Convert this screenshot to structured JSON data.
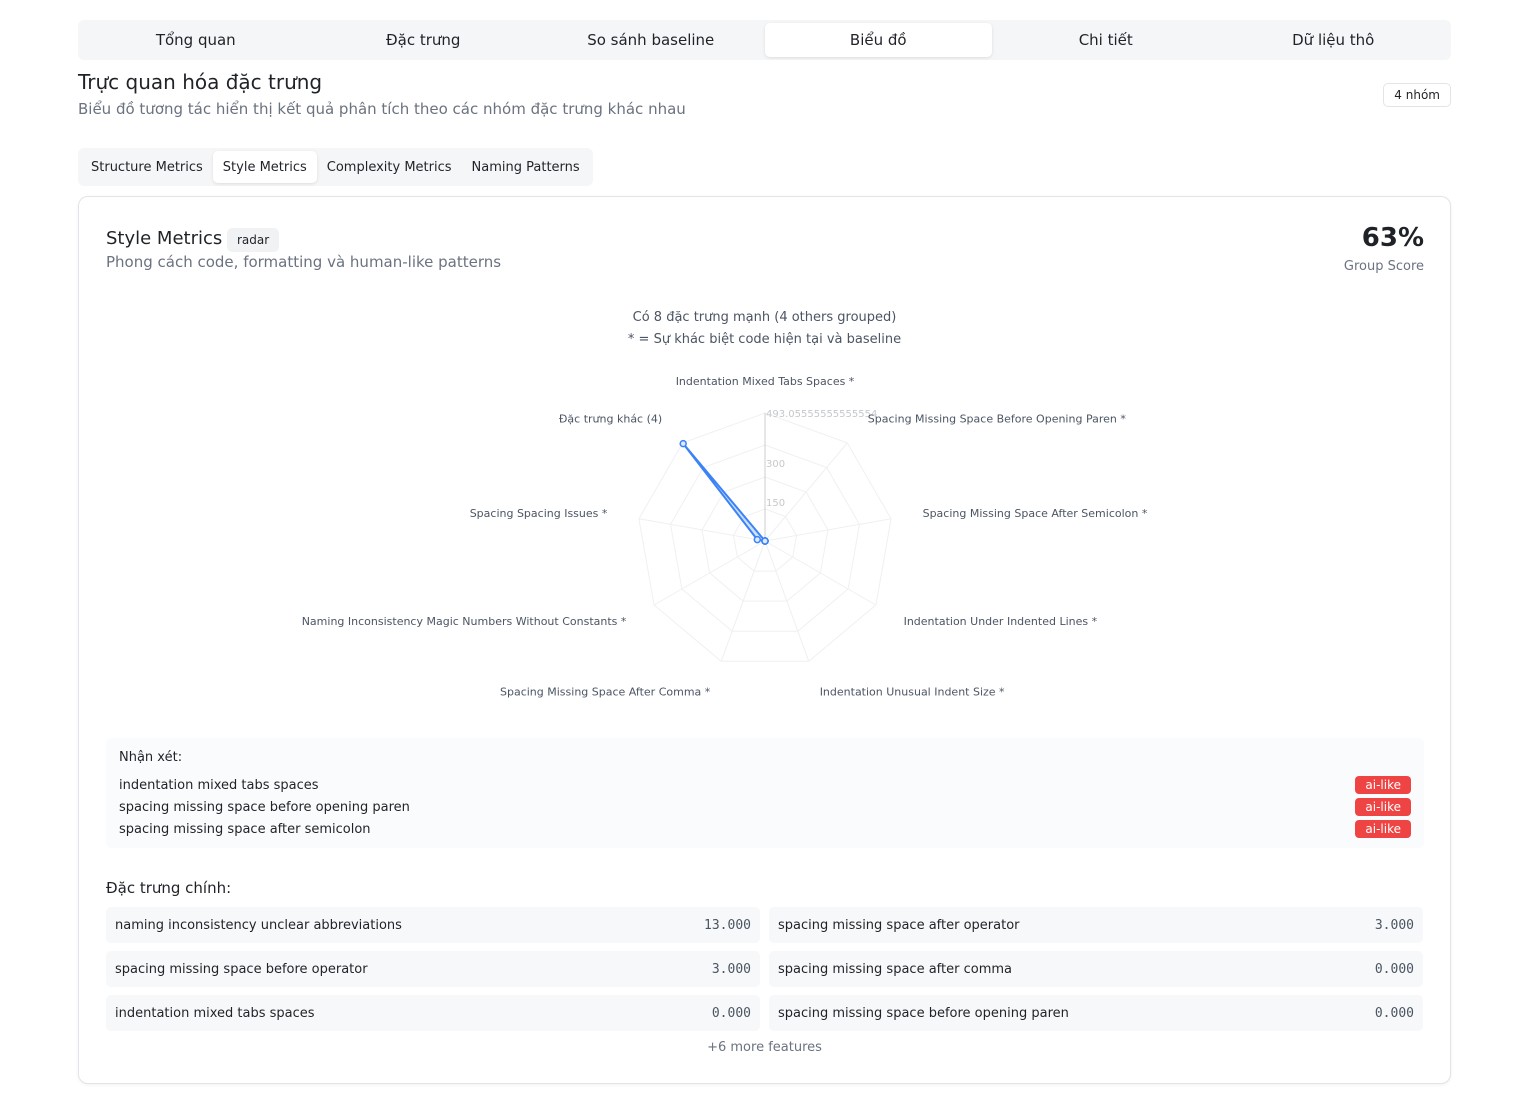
{
  "main_tabs": [
    {
      "label": "Tổng quan"
    },
    {
      "label": "Đặc trưng"
    },
    {
      "label": "So sánh baseline"
    },
    {
      "label": "Biểu đồ"
    },
    {
      "label": "Chi tiết"
    },
    {
      "label": "Dữ liệu thô"
    }
  ],
  "page": {
    "title": "Trực quan hóa đặc trưng",
    "subtitle": "Biểu đồ tương tác hiển thị kết quả phân tích theo các nhóm đặc trưng khác nhau",
    "group_count": "4 nhóm"
  },
  "sub_tabs": [
    {
      "label": "Structure Metrics"
    },
    {
      "label": "Style Metrics"
    },
    {
      "label": "Complexity Metrics"
    },
    {
      "label": "Naming Patterns"
    }
  ],
  "card": {
    "title": "Style Metrics",
    "type_badge": "radar",
    "description": "Phong cách code, formatting và human-like patterns",
    "score": "63%",
    "score_label": "Group Score",
    "note_line1": "Có 8 đặc trưng mạnh (4 others grouped)",
    "note_line2": "* = Sự khác biệt code hiện tại và baseline"
  },
  "chart_data": {
    "type": "radar",
    "categories": [
      "Indentation Mixed Tabs Spaces *",
      "Spacing Missing Space Before Opening Paren *",
      "Spacing Missing Space After Semicolon *",
      "Indentation Under Indented Lines *",
      "Indentation Unusual Indent Size *",
      "Spacing Missing Space After Comma *",
      "Naming Inconsistency Magic Numbers Without Constants *",
      "Spacing Spacing Issues *",
      "Đặc trưng khác (4)"
    ],
    "rmax": 493.05555555555554,
    "tick_labels": [
      "150",
      "300",
      "493.05555555555554"
    ],
    "tick_values": [
      150,
      300,
      493.05555555555554
    ],
    "series": [
      {
        "values": [
          0,
          0,
          0,
          0,
          0,
          0,
          0,
          30,
          490
        ],
        "color": "#3b82f6"
      }
    ],
    "grid": true
  },
  "remarks": {
    "title": "Nhận xét:",
    "items": [
      {
        "text": "indentation mixed tabs spaces",
        "badge": "ai-like"
      },
      {
        "text": "spacing missing space before opening paren",
        "badge": "ai-like"
      },
      {
        "text": "spacing missing space after semicolon",
        "badge": "ai-like"
      }
    ]
  },
  "features": {
    "title": "Đặc trưng chính:",
    "items": [
      {
        "name": "naming inconsistency unclear abbreviations",
        "value": "13.000"
      },
      {
        "name": "spacing missing space after operator",
        "value": "3.000"
      },
      {
        "name": "spacing missing space before operator",
        "value": "3.000"
      },
      {
        "name": "spacing missing space after comma",
        "value": "0.000"
      },
      {
        "name": "indentation mixed tabs spaces",
        "value": "0.000"
      },
      {
        "name": "spacing missing space before opening paren",
        "value": "0.000"
      }
    ],
    "more": "+6 more features"
  }
}
